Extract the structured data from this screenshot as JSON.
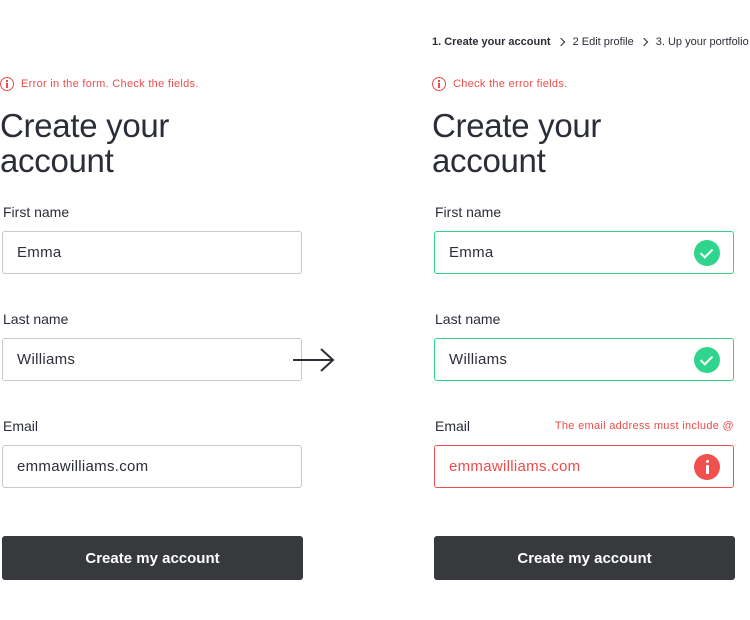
{
  "left_form": {
    "error_banner": "Error in the form. Check the fields.",
    "title_line1": "Create your",
    "title_line2": "account",
    "first_name": {
      "label": "First name",
      "value": "Emma"
    },
    "last_name": {
      "label": "Last name",
      "value": "Williams"
    },
    "email": {
      "label": "Email",
      "value": "emmawilliams.com"
    },
    "submit_label": "Create my account"
  },
  "right_form": {
    "breadcrumb": {
      "step1": "1. Create your account",
      "step2": "2 Edit profile",
      "step3": "3. Up your portfolio"
    },
    "error_banner": "Check the error fields.",
    "title_line1": "Create your",
    "title_line2": "account",
    "first_name": {
      "label": "First name",
      "value": "Emma",
      "status": "valid"
    },
    "last_name": {
      "label": "Last name",
      "value": "Williams",
      "status": "valid"
    },
    "email": {
      "label": "Email",
      "value": "emmawilliams.com",
      "status": "invalid",
      "error": "The email address must include @"
    },
    "submit_label": "Create my account"
  },
  "colors": {
    "text": "#2b2e38",
    "error": "#ee4c4c",
    "valid": "#2fd58d",
    "button": "#38393c",
    "border": "#c9c9cc"
  },
  "icons": [
    "info-icon",
    "check-icon",
    "alert-icon",
    "arrow-right-icon",
    "chevron-right-icon"
  ]
}
